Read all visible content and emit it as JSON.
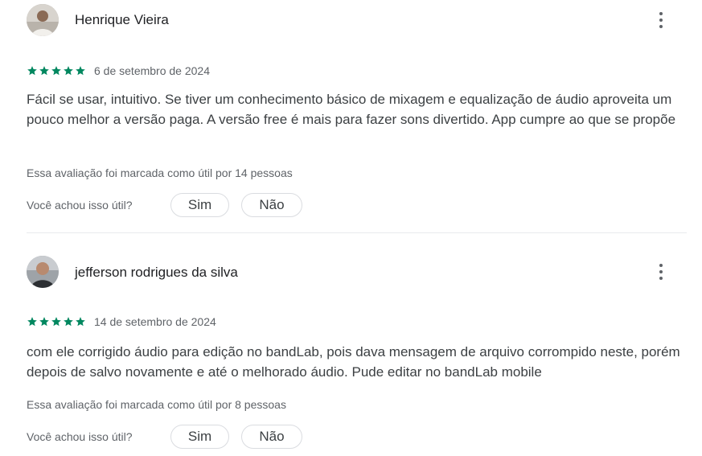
{
  "reviews": [
    {
      "author": "Henrique Vieira",
      "rating": 5,
      "date": "6 de setembro de 2024",
      "text": "Fácil se usar, intuitivo. Se tiver um conhecimento básico de mixagem e equalização de áudio aproveita um pouco melhor a versão paga. A versão free é mais para fazer sons divertido. App cumpre ao que se propõe",
      "helpful_count_text": "Essa avaliação foi marcada como útil por 14 pessoas",
      "helpful_question": "Você achou isso útil?",
      "yes_label": "Sim",
      "no_label": "Não"
    },
    {
      "author": "jefferson rodrigues da silva",
      "rating": 5,
      "date": "14 de setembro de 2024",
      "text": "com ele corrigido áudio para edição no bandLab, pois dava mensagem de arquivo corrompido neste, porém depois de salvo novamente e até o melhorado áudio. Pude editar no bandLab mobile",
      "helpful_count_text": "Essa avaliação foi marcada como útil por 8 pessoas",
      "helpful_question": "Você achou isso útil?",
      "yes_label": "Sim",
      "no_label": "Não"
    }
  ],
  "colors": {
    "star": "#01875f",
    "text": "#3c4043",
    "muted": "#5f6368",
    "border": "#dadce0"
  },
  "icons": {
    "more": "more-vert-icon",
    "star": "star-icon"
  }
}
